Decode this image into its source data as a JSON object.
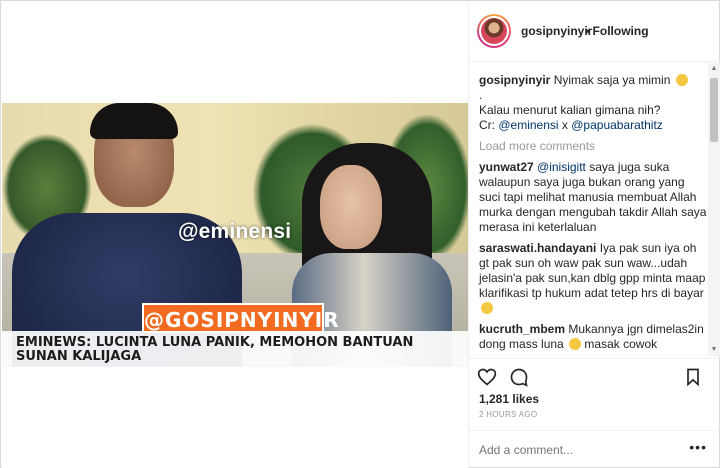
{
  "post": {
    "username": "gosipnyinyir",
    "follow_status": "• Following",
    "video": {
      "watermark": "@eminensi",
      "tag": "@GOSIPNYINYIR",
      "caption_line1": "EMINEWS: LUCINTA LUNA PANIK, MEMOHON BANTUAN",
      "caption_line2": "SUNAN KALIJAGA"
    }
  },
  "caption": {
    "username": "gosipnyinyir",
    "text1": "Nyimak saja ya mimin",
    "dot": ".",
    "text2": "Kalau menurut kalian gimana nih?",
    "credit_prefix": "Cr: ",
    "mention1": "@eminensi",
    "credit_mid": " x ",
    "mention2": "@papuabarathitz"
  },
  "load_more": "Load more comments",
  "comments": [
    {
      "user": "yunwat27",
      "mention": "@inisigitt",
      "text": " saya juga suka walaupun saya juga bukan orang yang suci tapi melihat manusia membuat Allah murka dengan mengubah takdir Allah saya merasa ini keterlaluan"
    },
    {
      "user": "saraswati.handayani",
      "mention": "",
      "text": " Iya pak sun iya oh gt pak sun oh waw pak sun waw...udah jelasin'a pak sun,kan dblg gpp minta maap klarifikasi tp hukum adat tetep hrs di bayar"
    },
    {
      "user": "kucruth_mbem",
      "mention": "",
      "text": " Mukannya jgn dimelas2in dong mass luna"
    },
    {
      "user": "",
      "mention": "",
      "text": "masak cowok cengengg"
    }
  ],
  "likes": "1,281 likes",
  "timestamp": "2 HOURS AGO",
  "add_comment_placeholder": "Add a comment...",
  "more_options": "•••",
  "colors": {
    "accent": "#003569",
    "tag_orange": "#f26b20"
  }
}
